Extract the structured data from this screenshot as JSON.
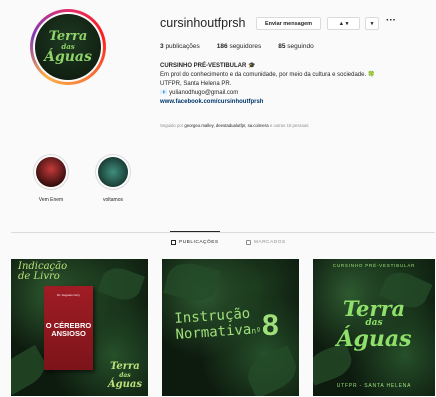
{
  "profile": {
    "avatar_text": [
      "Terra",
      "das",
      "Águas"
    ],
    "username": "cursinhoutfprsh",
    "message_button": "Enviar mensagem",
    "follow_button": "▲ ▾",
    "more_button": "▾",
    "options": "···",
    "stats": {
      "posts_count": "3",
      "posts_label": "publicações",
      "followers_count": "186",
      "followers_label": "seguidores",
      "following_count": "85",
      "following_label": "seguindo"
    },
    "bio": {
      "name": "CURSINHO PRÉ-VESTIBULAR 🎓",
      "line1": "Em prol do conhecimento e da comunidade, por meio da cultura e sociedade. 🍀",
      "line2": "UTFPR, Santa Helena PR.",
      "line3": "📧 yulianodhugo@gmail.com",
      "link": "www.facebook.com/cursinhoutfprsh"
    },
    "followed_by": {
      "prefix": "Seguido por",
      "names": "georgeo.malley, deestadualutfpr, sa.coimera",
      "suffix": "e outras 15 pessoas"
    }
  },
  "highlights": [
    {
      "label": "Vem Enem"
    },
    {
      "label": "voltamos"
    }
  ],
  "tabs": [
    {
      "label": "PUBLICAÇÕES",
      "active": true
    },
    {
      "label": "MARCADOS",
      "active": false
    }
  ],
  "posts": {
    "p1": {
      "headline": [
        "Indicação",
        "de Livro"
      ],
      "book_author": "Dr. Augusto Cury",
      "book_title": [
        "O CÉREBRO",
        "ANSIOSO"
      ],
      "logo": [
        "Terra",
        "das",
        "Águas"
      ]
    },
    "p2": {
      "line1": "Instrução",
      "line2": "Normativa",
      "sup": "nº",
      "number": "8"
    },
    "p3": {
      "top": "CURSINHO PRÉ-VESTIBULAR",
      "logo": [
        "Terra",
        "das",
        "Águas"
      ],
      "bottom": "UTFPR - SANTA HELENA"
    }
  },
  "colors": {
    "background": "#fafafa",
    "accent_green": "#9fe07a",
    "link_blue": "#00376b",
    "muted": "#8e8e8e"
  }
}
